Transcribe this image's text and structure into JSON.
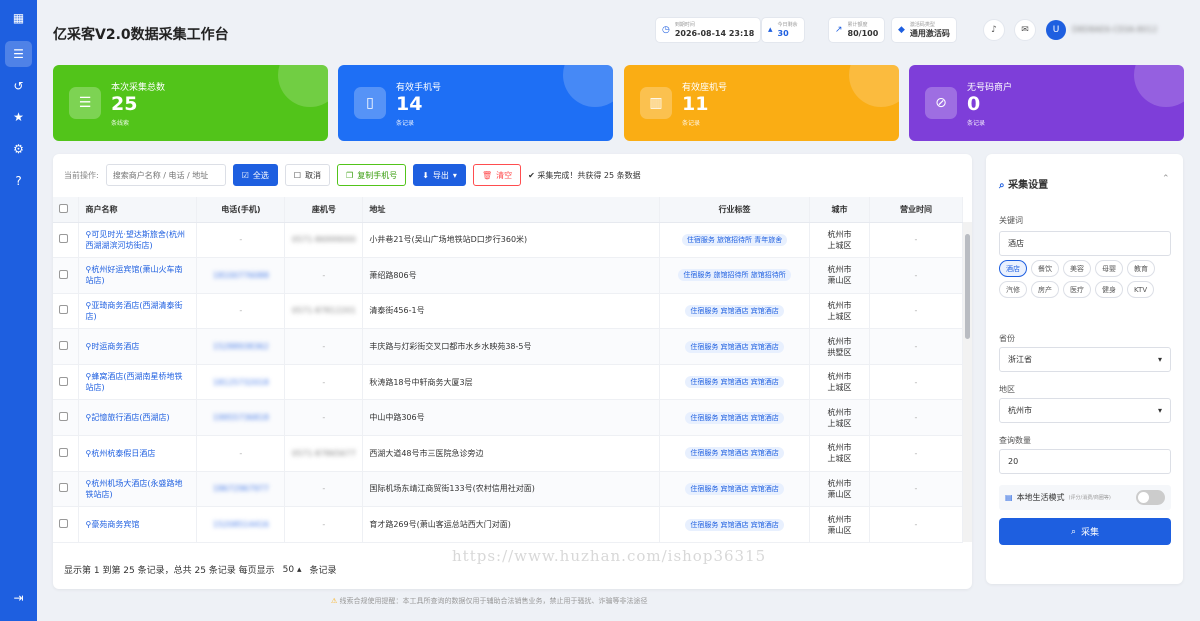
{
  "sidebar": {
    "icons": [
      "grid-icon",
      "database-icon",
      "history-icon",
      "star-icon",
      "gear-icon",
      "help-icon"
    ],
    "logout_icon": "logout-icon"
  },
  "header": {
    "title": "亿采客V2.0数据采集工作台",
    "expire": {
      "label": "到期时间",
      "value": "2026-08-14 23:18"
    },
    "today": {
      "label": "今日剩余",
      "value": "30"
    },
    "quota": {
      "label": "累计额度",
      "value": "80/100"
    },
    "code_type": {
      "label": "激活码类型",
      "value": "通用激活码"
    },
    "user_id": "D8D8AE6-CE0A-8012"
  },
  "cards": [
    {
      "label": "本次采集总数",
      "value": "25",
      "sub": "条线索",
      "color": "#52c41a",
      "icon": "database-icon"
    },
    {
      "label": "有效手机号",
      "value": "14",
      "sub": "条记录",
      "color": "#1e6ff5",
      "icon": "mobile-icon"
    },
    {
      "label": "有效座机号",
      "value": "11",
      "sub": "条记录",
      "color": "#faad14",
      "icon": "building-icon"
    },
    {
      "label": "无号码商户",
      "value": "0",
      "sub": "条记录",
      "color": "#7e3ed9",
      "icon": "ban-icon"
    }
  ],
  "toolbar": {
    "label": "当前操作:",
    "search_placeholder": "搜索商户名称 / 电话 / 地址",
    "select_all": "全选",
    "cancel": "取消",
    "copy_mobile": "复制手机号",
    "export": "导出",
    "clear": "清空",
    "status": "采集完成！共获得 25 条数据"
  },
  "table": {
    "headers": [
      "商户名称",
      "电话(手机)",
      "座机号",
      "地址",
      "行业标签",
      "城市",
      "营业时间"
    ],
    "rows": [
      {
        "name": "可见时光·望达斯旅舍(杭州西湖湖滨河坊街店)",
        "mobile": "-",
        "landline": "0571-86999000",
        "address": "小井巷21号(吴山广场地铁站D口步行360米)",
        "tags": "住宿服务 旅馆招待所 青年旅舍",
        "city": "杭州市",
        "district": "上城区",
        "hours": "-"
      },
      {
        "name": "杭州好运宾馆(萧山火车南站店)",
        "mobile": "18100776088",
        "landline": "-",
        "address": "萧绍路806号",
        "tags": "住宿服务 旅馆招待所 旅馆招待所",
        "city": "杭州市",
        "district": "萧山区",
        "hours": "-"
      },
      {
        "name": "亚琦商务酒店(西湖清泰街店)",
        "mobile": "-",
        "landline": "0571-87812201",
        "address": "清泰街456-1号",
        "tags": "住宿服务 宾馆酒店 宾馆酒店",
        "city": "杭州市",
        "district": "上城区",
        "hours": "-"
      },
      {
        "name": "时运商务酒店",
        "mobile": "15288938362",
        "landline": "-",
        "address": "丰庆路与灯彩街交叉口都市水乡水映苑38-5号",
        "tags": "住宿服务 宾馆酒店 宾馆酒店",
        "city": "杭州市",
        "district": "拱墅区",
        "hours": "-"
      },
      {
        "name": "蜂窝酒店(西湖南星桥地铁站店)",
        "mobile": "18125732018",
        "landline": "-",
        "address": "秋涛路18号中轩商务大厦3层",
        "tags": "住宿服务 宾馆酒店 宾馆酒店",
        "city": "杭州市",
        "district": "上城区",
        "hours": "-"
      },
      {
        "name": "記憶旅行酒店(西湖店)",
        "mobile": "19955736818",
        "landline": "-",
        "address": "中山中路306号",
        "tags": "住宿服务 宾馆酒店 宾馆酒店",
        "city": "杭州市",
        "district": "上城区",
        "hours": "-"
      },
      {
        "name": "杭州杭泰假日酒店",
        "mobile": "-",
        "landline": "0571-87865677",
        "address": "西湖大道48号市三医院急诊旁边",
        "tags": "住宿服务 宾馆酒店 宾馆酒店",
        "city": "杭州市",
        "district": "上城区",
        "hours": "-"
      },
      {
        "name": "杭州机场大酒店(永盛路地铁站店)",
        "mobile": "18672967977",
        "landline": "-",
        "address": "国际机场东靖江商贸街133号(农村信用社对面)",
        "tags": "住宿服务 宾馆酒店 宾馆酒店",
        "city": "杭州市",
        "district": "萧山区",
        "hours": "-"
      },
      {
        "name": "豪苑商务宾馆",
        "mobile": "15208514416",
        "landline": "-",
        "address": "育才路269号(萧山客运总站西大门对面)",
        "tags": "住宿服务 宾馆酒店 宾馆酒店",
        "city": "杭州市",
        "district": "萧山区",
        "hours": "-"
      }
    ]
  },
  "pagination": {
    "summary": "显示第 1 到第 25 条记录，总共 25 条记录 每页显示",
    "page_size": "50",
    "suffix": "条记录"
  },
  "notice": "线索合规使用提醒：本工具所查询的数据仅用于辅助合法销售业务，禁止用于骚扰、诈骗等非法途径",
  "watermark": "https://www.huzhan.com/ishop36315",
  "settings": {
    "title": "采集设置",
    "keyword_label": "关键词",
    "keyword_value": "酒店",
    "chips": [
      "酒店",
      "餐饮",
      "美容",
      "母婴",
      "教育",
      "汽修",
      "房产",
      "医疗",
      "健身",
      "KTV"
    ],
    "province_label": "省份",
    "province_value": "浙江省",
    "region_label": "地区",
    "region_value": "杭州市",
    "count_label": "查询数量",
    "count_value": "20",
    "life_mode_label": "本地生活模式",
    "life_mode_note": "(评分/消费/商圈等)",
    "collect_button": "采集"
  }
}
